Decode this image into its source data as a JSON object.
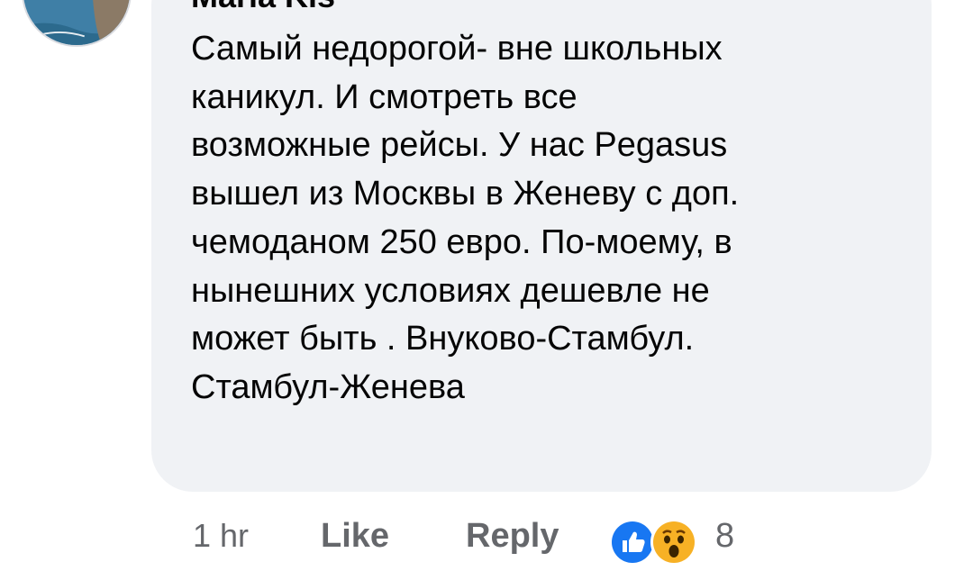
{
  "comment": {
    "author": "Maria Kis",
    "text_lines": [
      "Самый недорогой- вне школьных",
      "каникул. И смотреть все",
      "возможные рейсы. У нас Pegasus",
      "вышел из Москвы в Женеву с доп.",
      "чемоданом 250 евро. По-моему, в",
      "нынешних условиях дешевле не",
      "может быть . Внуково-Стамбул.",
      "Стамбул-Женева"
    ]
  },
  "actions": {
    "time": "1 hr",
    "like_label": "Like",
    "reply_label": "Reply",
    "reactions": [
      "like-icon",
      "wow-icon"
    ],
    "reaction_count": "8"
  },
  "colors": {
    "bubble": "#f0f2f5",
    "text": "#050505",
    "secondary": "#65676b",
    "like_blue": "#1877f2",
    "wow_yellow": "#f7b125"
  }
}
